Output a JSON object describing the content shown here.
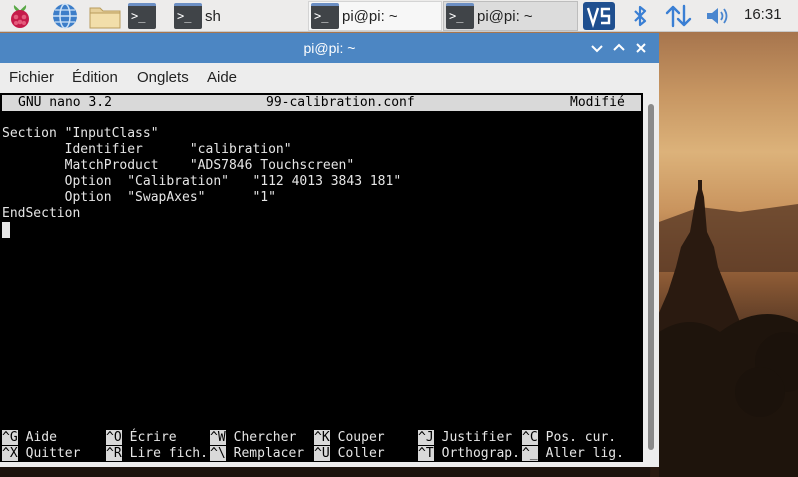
{
  "panel": {
    "launcher_icon": "raspberry-icon",
    "tasks": [
      {
        "label": "",
        "icon": "terminal-icon"
      },
      {
        "label": "sh",
        "icon": "terminal-icon"
      },
      {
        "label": "pi@pi: ~",
        "icon": "terminal-icon"
      },
      {
        "label": "pi@pi: ~",
        "icon": "terminal-icon"
      }
    ],
    "tray": [
      "vnc-icon",
      "bluetooth-icon",
      "network-arrows-icon",
      "volume-icon"
    ],
    "clock": "16:31",
    "colors": {
      "panel_bg": "#edeceb",
      "vnc_blue": "#1f4f8f",
      "bluetooth_blue": "#3a7fd4"
    }
  },
  "window": {
    "title": "pi@pi: ~",
    "title_color": "#4c86c3",
    "buttons": [
      "minimize-icon",
      "maximize-icon",
      "close-icon"
    ],
    "menu": [
      "Fichier",
      "Édition",
      "Onglets",
      "Aide"
    ]
  },
  "nano": {
    "version": "GNU nano 3.2",
    "filename": "99-calibration.conf",
    "status": "Modifié",
    "lines": [
      "Section \"InputClass\"",
      "        Identifier      \"calibration\"",
      "        MatchProduct    \"ADS7846 Touchscreen\"",
      "        Option  \"Calibration\"   \"112 4013 3843 181\"",
      "        Option  \"SwapAxes\"      \"1\"",
      "EndSection"
    ],
    "shortcuts_row1": [
      {
        "key": "^G",
        "label": "Aide"
      },
      {
        "key": "^O",
        "label": "Écrire"
      },
      {
        "key": "^W",
        "label": "Chercher"
      },
      {
        "key": "^K",
        "label": "Couper"
      },
      {
        "key": "^J",
        "label": "Justifier"
      },
      {
        "key": "^C",
        "label": "Pos. cur."
      }
    ],
    "shortcuts_row2": [
      {
        "key": "^X",
        "label": "Quitter"
      },
      {
        "key": "^R",
        "label": "Lire fich."
      },
      {
        "key": "^\\",
        "label": "Remplacer"
      },
      {
        "key": "^U",
        "label": "Coller"
      },
      {
        "key": "^T",
        "label": "Orthograp."
      },
      {
        "key": "^_",
        "label": "Aller lig."
      }
    ]
  }
}
